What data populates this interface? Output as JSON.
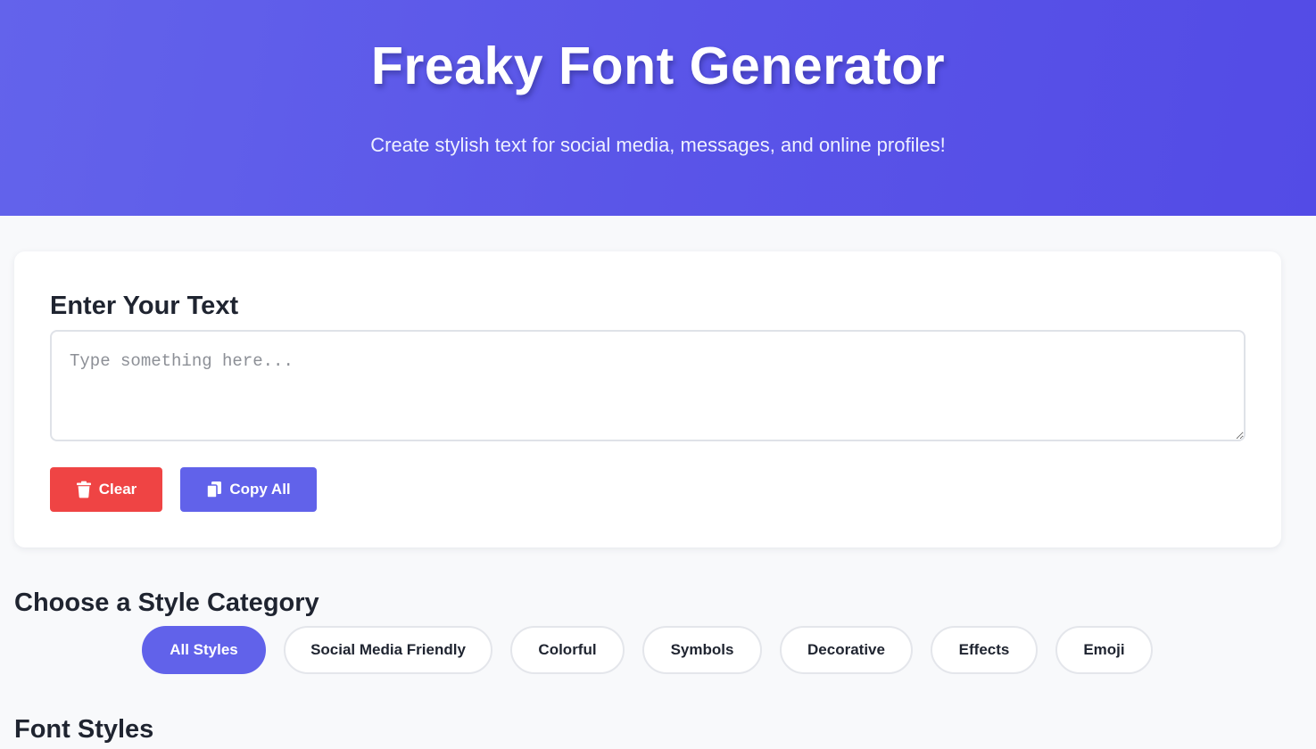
{
  "header": {
    "title": "Freaky Font Generator",
    "subtitle": "Create stylish text for social media, messages, and online profiles!"
  },
  "input_card": {
    "heading": "Enter Your Text",
    "placeholder": "Type something here...",
    "value": "",
    "clear_label": "Clear",
    "clear_icon": "trash-icon",
    "copy_label": "Copy All",
    "copy_icon": "copy-icon"
  },
  "categories": {
    "heading": "Choose a Style Category",
    "items": [
      {
        "label": "All Styles",
        "active": true
      },
      {
        "label": "Social Media Friendly",
        "active": false
      },
      {
        "label": "Colorful",
        "active": false
      },
      {
        "label": "Symbols",
        "active": false
      },
      {
        "label": "Decorative",
        "active": false
      },
      {
        "label": "Effects",
        "active": false
      },
      {
        "label": "Emoji",
        "active": false
      }
    ]
  },
  "font_styles": {
    "heading": "Font Styles"
  },
  "colors": {
    "accent": "#6162ea",
    "danger": "#ef4444",
    "header_gradient_start": "#6363eb",
    "header_gradient_end": "#534be6"
  }
}
